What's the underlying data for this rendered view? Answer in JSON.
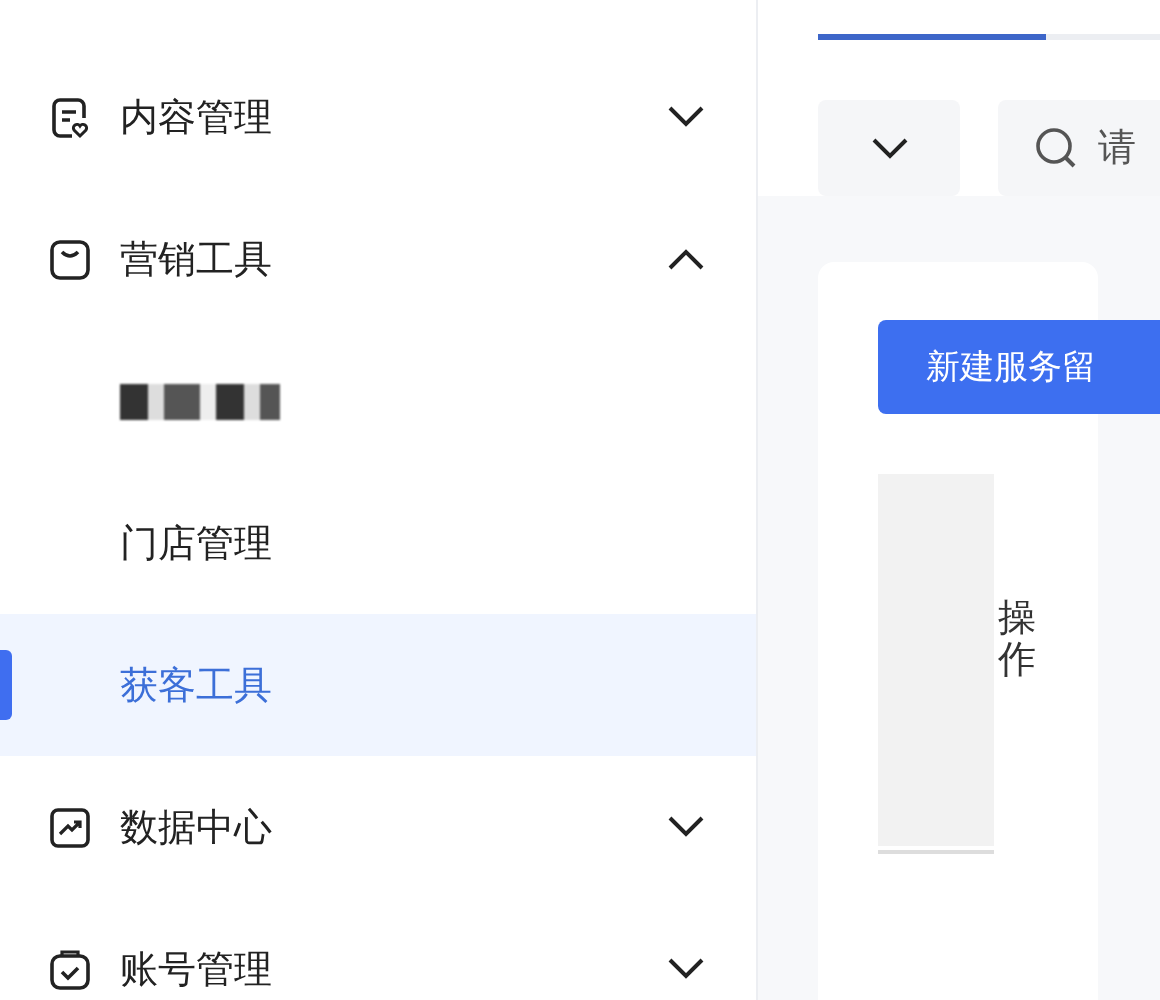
{
  "sidebar": {
    "items": [
      {
        "label": "内容管理",
        "expanded": false
      },
      {
        "label": "营销工具",
        "expanded": true,
        "children": [
          {
            "kind": "redacted",
            "selected": false
          },
          {
            "kind": "link",
            "label": "门店管理",
            "selected": false
          },
          {
            "kind": "link",
            "label": "获客工具",
            "selected": true
          }
        ]
      },
      {
        "label": "数据中心",
        "expanded": false
      },
      {
        "label": "账号管理",
        "expanded": false
      }
    ]
  },
  "tabs": [
    {
      "selected": true
    },
    {
      "selected": false
    }
  ],
  "search": {
    "placeholder": "请"
  },
  "new_button": "新建服务留",
  "table": {
    "columns": [
      {
        "kind": "blank"
      },
      {
        "kind": "header",
        "label": "操作"
      }
    ]
  }
}
